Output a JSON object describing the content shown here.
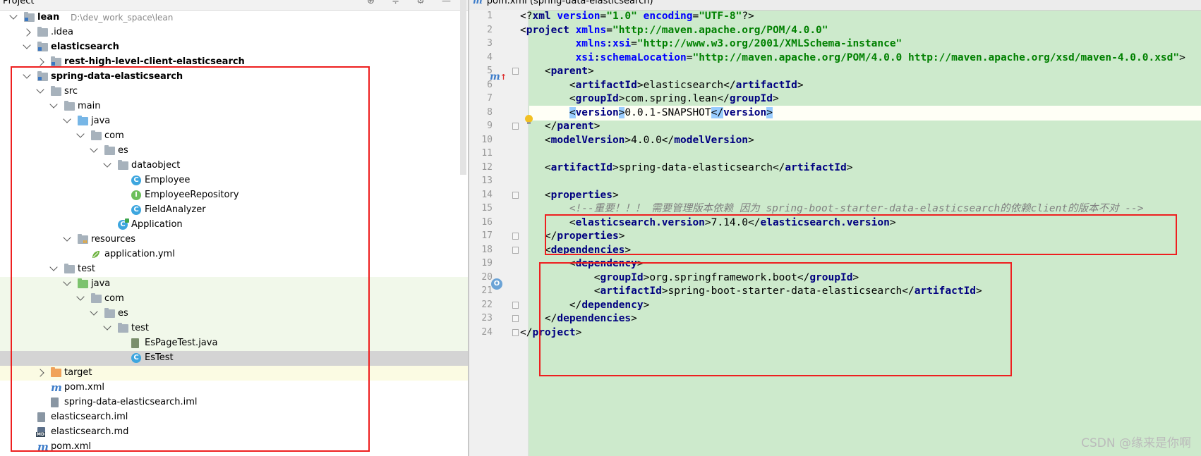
{
  "project_pane": {
    "title": "Project",
    "tools": "⊕ ≑ ⚙ —",
    "tree": [
      {
        "label": "lean",
        "path": "D:\\dev_work_space\\lean",
        "bold": true,
        "icon": "module-folder-icon",
        "expanded": true
      },
      {
        "label": ".idea",
        "icon": "folder-icon",
        "expanded": false
      },
      {
        "label": "elasticsearch",
        "bold": true,
        "icon": "module-folder-icon",
        "expanded": true
      },
      {
        "label": "rest-high-level-client-elasticsearch",
        "bold": true,
        "icon": "module-folder-icon",
        "expanded": false
      },
      {
        "label": "spring-data-elasticsearch",
        "bold": true,
        "icon": "module-folder-icon",
        "expanded": true
      },
      {
        "label": "src",
        "icon": "folder-icon",
        "expanded": true
      },
      {
        "label": "main",
        "icon": "folder-icon",
        "expanded": true
      },
      {
        "label": "java",
        "icon": "source-folder-icon",
        "expanded": true
      },
      {
        "label": "com",
        "icon": "package-icon",
        "expanded": true
      },
      {
        "label": "es",
        "icon": "package-icon",
        "expanded": true
      },
      {
        "label": "dataobject",
        "icon": "package-icon",
        "expanded": true
      },
      {
        "label": "Employee",
        "icon": "class-icon",
        "glyph": "C"
      },
      {
        "label": "EmployeeRepository",
        "icon": "interface-icon",
        "glyph": "I"
      },
      {
        "label": "FieldAnalyzer",
        "icon": "class-icon",
        "glyph": "C"
      },
      {
        "label": "Application",
        "icon": "spring-app-class-icon",
        "glyph": "C"
      },
      {
        "label": "resources",
        "icon": "resources-folder-icon",
        "expanded": true
      },
      {
        "label": "application.yml",
        "icon": "spring-yml-icon"
      },
      {
        "label": "test",
        "icon": "folder-icon",
        "expanded": true
      },
      {
        "label": "java",
        "icon": "test-source-folder-icon",
        "expanded": true
      },
      {
        "label": "com",
        "icon": "package-icon",
        "expanded": true
      },
      {
        "label": "es",
        "icon": "package-icon",
        "expanded": true
      },
      {
        "label": "test",
        "icon": "package-icon",
        "expanded": true
      },
      {
        "label": "EsPageTest.java",
        "icon": "java-file-icon"
      },
      {
        "label": "EsTest",
        "icon": "class-icon",
        "glyph": "C",
        "selected": true
      },
      {
        "label": "target",
        "icon": "excluded-folder-icon",
        "expanded": false
      },
      {
        "label": "pom.xml",
        "icon": "maven-icon",
        "glyph": "m"
      },
      {
        "label": "spring-data-elasticsearch.iml",
        "icon": "iml-file-icon"
      },
      {
        "label": "elasticsearch.iml",
        "icon": "iml-file-icon"
      },
      {
        "label": "elasticsearch.md",
        "icon": "md-file-icon",
        "glyph": "MD"
      },
      {
        "label": "pom.xml",
        "icon": "maven-icon",
        "glyph": "m"
      }
    ]
  },
  "editor": {
    "tab_label": "pom.xml (spring-data-elasticsearch)",
    "tab_glyph": "m",
    "line_numbers": [
      "1",
      "2",
      "3",
      "4",
      "5",
      "6",
      "7",
      "8",
      "9",
      "10",
      "11",
      "12",
      "13",
      "14",
      "15",
      "16",
      "17",
      "18",
      "19",
      "20",
      "21",
      "22",
      "23",
      "24"
    ],
    "gutter_markers": {
      "maven": "m",
      "maven_arrow": "↑",
      "spring": "O"
    },
    "lines": [
      [
        "br:<?",
        "tg:xml ",
        "at:version",
        "br:=",
        "av:\"1.0\" ",
        "at:encoding",
        "br:=",
        "av:\"UTF-8\"",
        "br:?>"
      ],
      [
        "br:<",
        "tg:project ",
        "at:xmlns",
        "br:=",
        "av:\"http://maven.apache.org/POM/4.0.0\""
      ],
      [
        "br:         ",
        "at:xmlns",
        "tg::",
        "at:xsi",
        "br:=",
        "av:\"http://www.w3.org/2001/XMLSchema-instance\""
      ],
      [
        "br:         ",
        "at:xsi",
        "tg::",
        "at:schemaLocation",
        "br:=",
        "av:\"http://maven.apache.org/POM/4.0.0 http://maven.apache.org/xsd/maven-4.0.0.xsd\"",
        "br:>"
      ],
      [
        "br:    <",
        "tg:parent",
        "br:>"
      ],
      [
        "br:        <",
        "tg:artifactId",
        "br:>elasticsearch</",
        "tg:artifactId",
        "br:>"
      ],
      [
        "br:        <",
        "tg:groupId",
        "br:>com.spring.lean</",
        "tg:groupId",
        "br:>"
      ],
      [
        "br:        ",
        "hl:<",
        "tg:version",
        "hl:>",
        "br:0.0.1-SNAPSHOT",
        "hl:</",
        "tg:version",
        "hl:>"
      ],
      [
        "br:    </",
        "tg:parent",
        "br:>"
      ],
      [
        "br:    <",
        "tg:modelVersion",
        "br:>4.0.0</",
        "tg:modelVersion",
        "br:>"
      ],
      [
        "br:"
      ],
      [
        "br:    <",
        "tg:artifactId",
        "br:>spring-data-elasticsearch</",
        "tg:artifactId",
        "br:>"
      ],
      [
        "br:"
      ],
      [
        "br:    <",
        "tg:properties",
        "br:>"
      ],
      [
        "br:        ",
        "cm:<!--重要！！！ 需要管理版本依赖 因为 spring-boot-starter-data-elasticsearch的依赖client的版本不对 -->"
      ],
      [
        "br:        <",
        "tg:elasticsearch.version",
        "br:>7.14.0</",
        "tg:elasticsearch.version",
        "br:>"
      ],
      [
        "br:    </",
        "tg:properties",
        "br:>"
      ],
      [
        "br:    <",
        "tg:dependencies",
        "br:>"
      ],
      [
        "br:        <",
        "tg:dependency",
        "br:>"
      ],
      [
        "br:            <",
        "tg:groupId",
        "br:>org.springframework.boot</",
        "tg:groupId",
        "br:>"
      ],
      [
        "br:            <",
        "tg:artifactId",
        "br:>spring-boot-starter-data-elasticsearch</",
        "tg:artifactId",
        "br:>"
      ],
      [
        "br:        </",
        "tg:dependency",
        "br:>"
      ],
      [
        "br:    </",
        "tg:dependencies",
        "br:>"
      ],
      [
        "br:</",
        "tg:project",
        "br:>"
      ]
    ]
  },
  "watermark": "CSDN @缘来是你啊",
  "colors": {
    "annotation_box": "#ee1f1f",
    "editor_bg": "#cdeacc",
    "xml_tag": "#000080",
    "xml_attr": "#0000ff",
    "xml_value": "#008000",
    "comment": "#808080"
  }
}
